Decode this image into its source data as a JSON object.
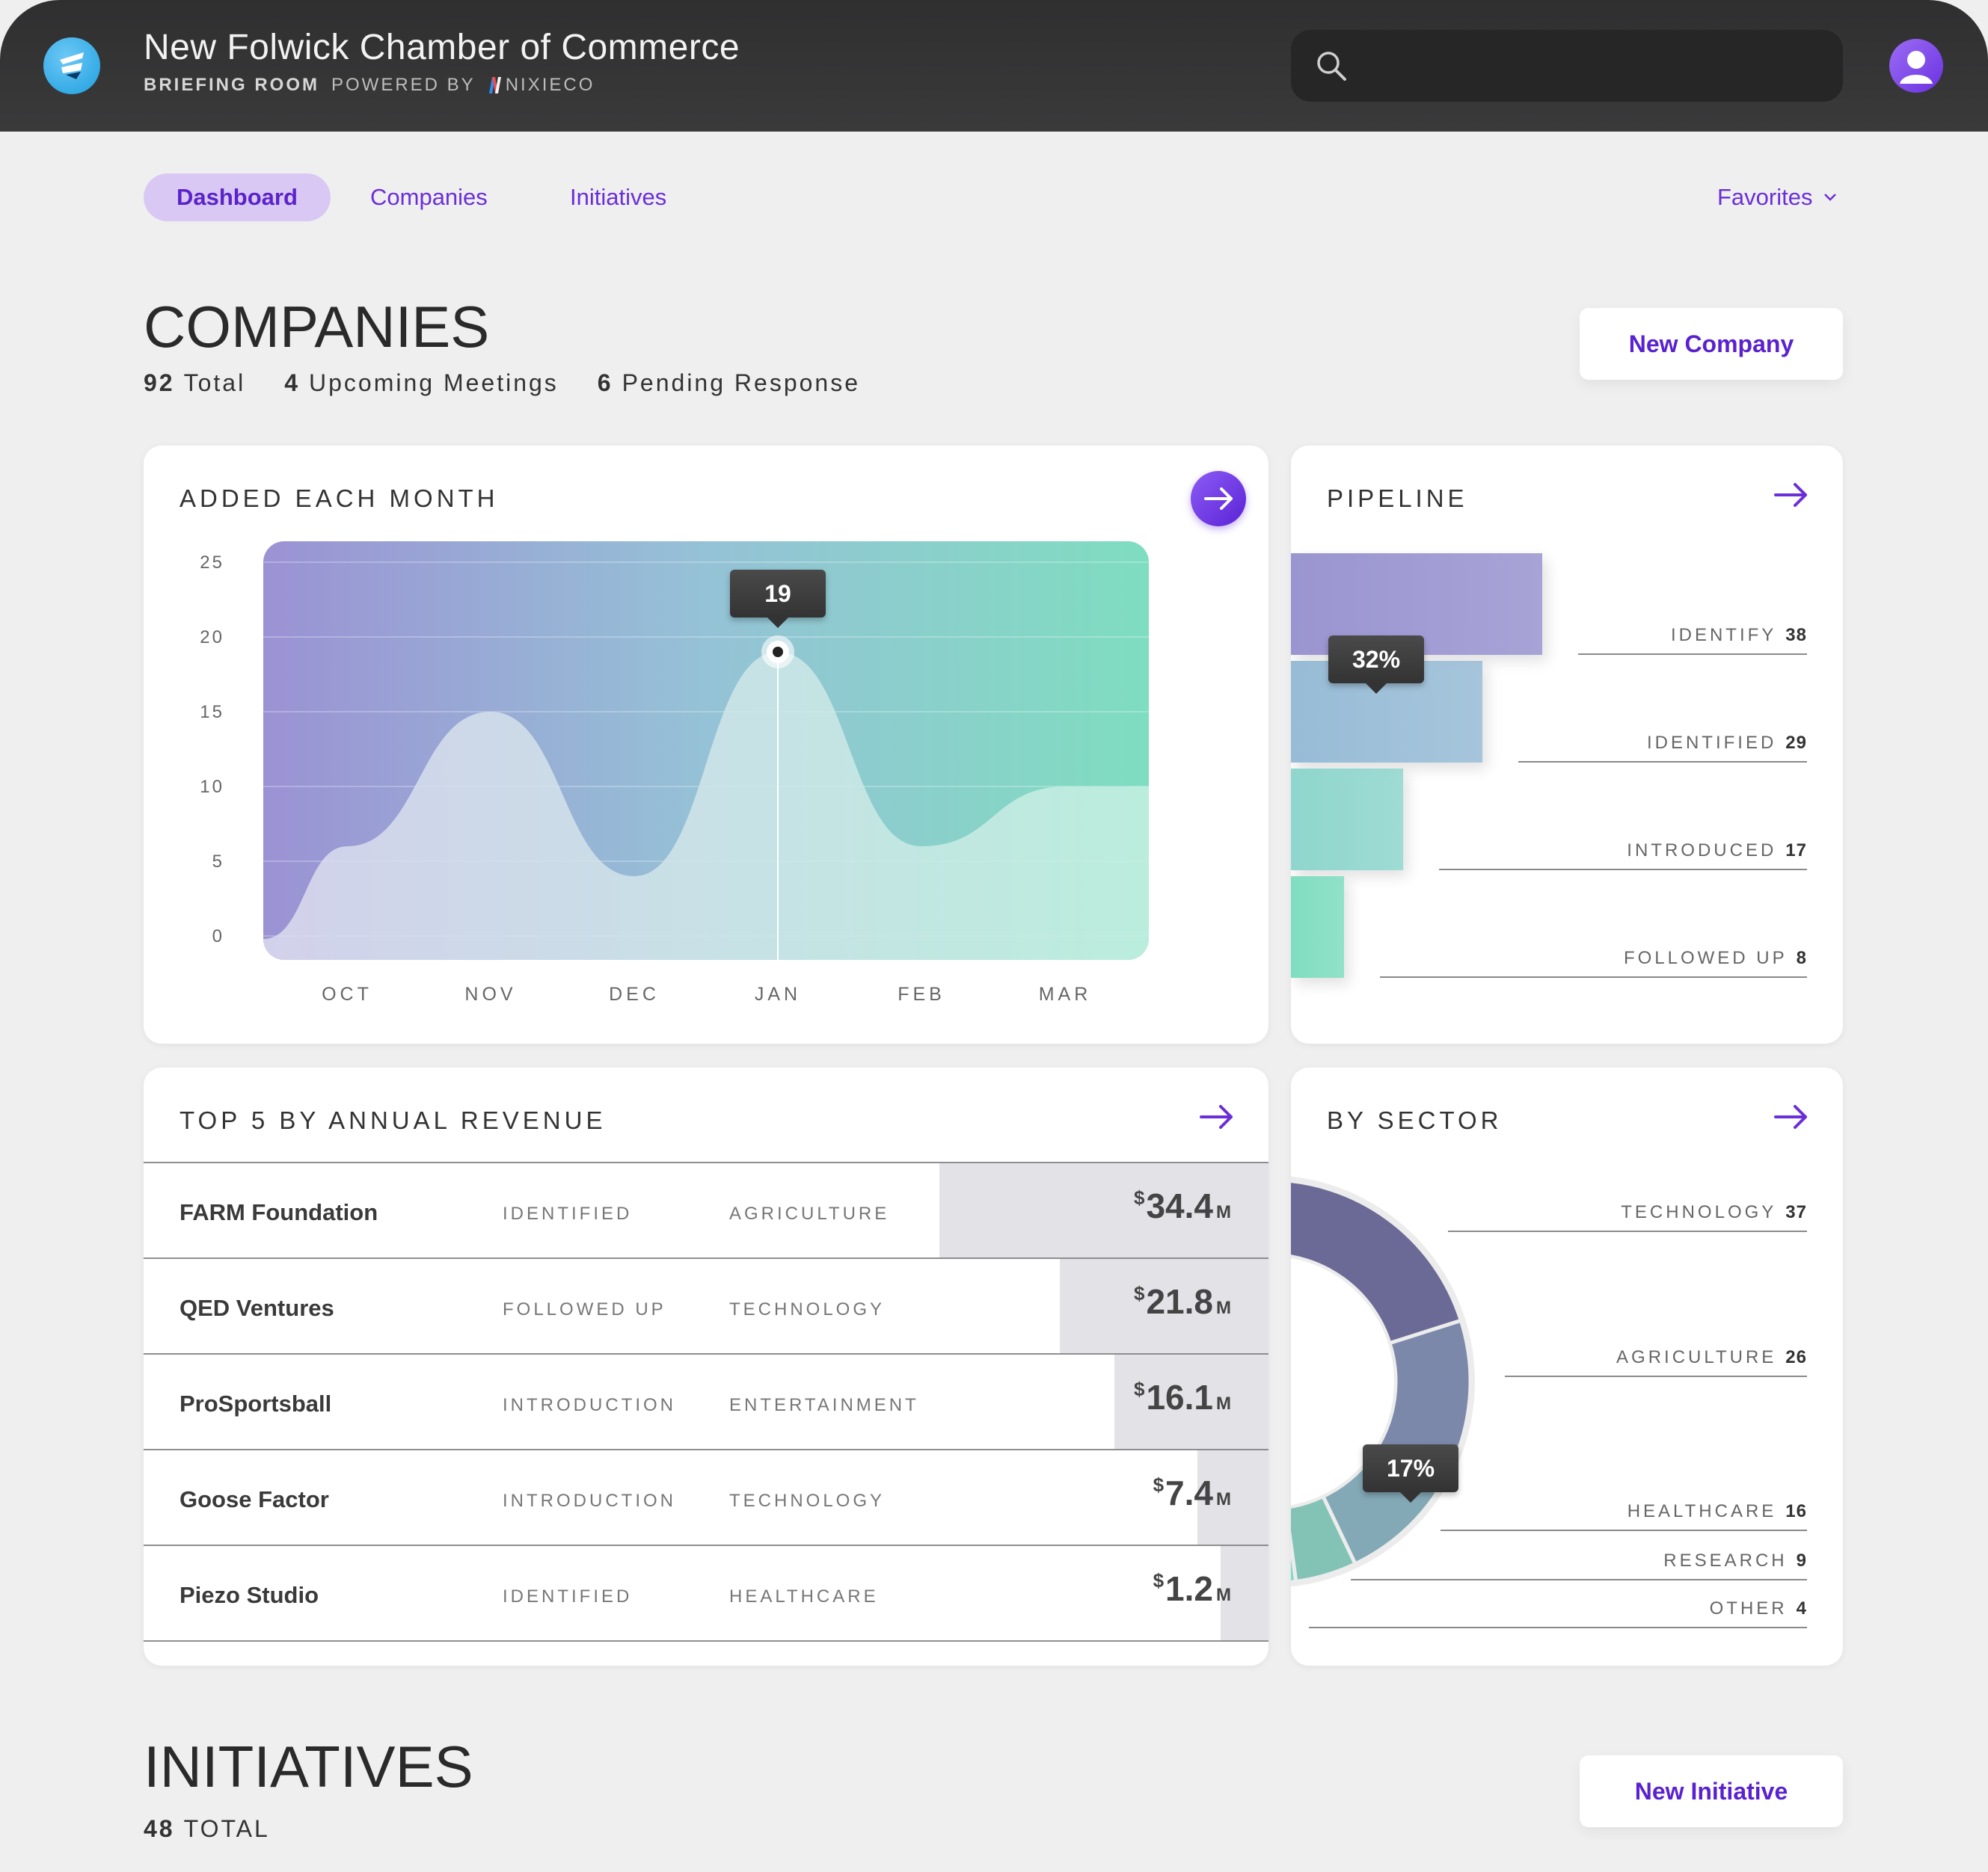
{
  "header": {
    "app_title": "New Folwick Chamber of Commerce",
    "app_subtitle_bold": "BRIEFING ROOM",
    "app_subtitle": "POWERED BY",
    "brand": "NIXIECO",
    "search_placeholder": ""
  },
  "nav": {
    "tabs": [
      {
        "label": "Dashboard",
        "active": true
      },
      {
        "label": "Companies",
        "active": false
      },
      {
        "label": "Initiatives",
        "active": false
      }
    ],
    "favorites_label": "Favorites"
  },
  "companies": {
    "title": "COMPANIES",
    "stats": [
      {
        "count": "92",
        "label": "Total"
      },
      {
        "count": "4",
        "label": "Upcoming Meetings"
      },
      {
        "count": "6",
        "label": "Pending Response"
      }
    ],
    "new_button_label": "New Company"
  },
  "added_card": {
    "title": "ADDED EACH MONTH",
    "tooltip": "19"
  },
  "pipeline_card": {
    "title": "PIPELINE",
    "tooltip": "32%",
    "stages": [
      {
        "label": "IDENTIFY",
        "value": "38"
      },
      {
        "label": "IDENTIFIED",
        "value": "29"
      },
      {
        "label": "INTRODUCED",
        "value": "17"
      },
      {
        "label": "FOLLOWED UP",
        "value": "8"
      }
    ]
  },
  "revenue_card": {
    "title": "TOP 5 BY ANNUAL REVENUE",
    "rows": [
      {
        "name": "FARM Foundation",
        "stage": "IDENTIFIED",
        "sector": "AGRICULTURE",
        "currency": "$",
        "value": "34.4",
        "unit": "M",
        "amount": 34.4
      },
      {
        "name": "QED Ventures",
        "stage": "FOLLOWED UP",
        "sector": "TECHNOLOGY",
        "currency": "$",
        "value": "21.8",
        "unit": "M",
        "amount": 21.8
      },
      {
        "name": "ProSportsball",
        "stage": "INTRODUCTION",
        "sector": "ENTERTAINMENT",
        "currency": "$",
        "value": "16.1",
        "unit": "M",
        "amount": 16.1
      },
      {
        "name": "Goose Factor",
        "stage": "INTRODUCTION",
        "sector": "TECHNOLOGY",
        "currency": "$",
        "value": "7.4",
        "unit": "M",
        "amount": 7.4
      },
      {
        "name": "Piezo Studio",
        "stage": "IDENTIFIED",
        "sector": "HEALTHCARE",
        "currency": "$",
        "value": "1.2",
        "unit": "M",
        "amount": 1.2
      }
    ]
  },
  "sector_card": {
    "title": "BY SECTOR",
    "tooltip": "17%",
    "sectors": [
      {
        "label": "TECHNOLOGY",
        "value": "37"
      },
      {
        "label": "AGRICULTURE",
        "value": "26"
      },
      {
        "label": "HEALTHCARE",
        "value": "16"
      },
      {
        "label": "RESEARCH",
        "value": "9"
      },
      {
        "label": "OTHER",
        "value": "4"
      }
    ]
  },
  "initiatives": {
    "title": "INITIATIVES",
    "total_count": "48",
    "total_label": "TOTAL",
    "new_button_label": "New Initiative"
  },
  "colors": {
    "accent": "#6b2fd9",
    "purple": "#9b8fd3",
    "teal": "#7fdcbf",
    "donut_dark": "#6a6b96"
  },
  "chart_data": [
    {
      "type": "area",
      "title": "ADDED EACH MONTH",
      "categories": [
        "OCT",
        "NOV",
        "DEC",
        "JAN",
        "FEB",
        "MAR"
      ],
      "values": [
        6,
        15,
        4,
        19,
        6,
        10
      ],
      "ylim": [
        0,
        25
      ],
      "yticks": [
        0,
        5,
        10,
        15,
        20,
        25
      ],
      "highlight": {
        "category": "JAN",
        "value": 19
      }
    },
    {
      "type": "bar",
      "title": "PIPELINE",
      "categories": [
        "IDENTIFY",
        "IDENTIFIED",
        "INTRODUCED",
        "FOLLOWED UP"
      ],
      "values": [
        38,
        29,
        17,
        8
      ]
    },
    {
      "type": "pie",
      "title": "BY SECTOR",
      "categories": [
        "TECHNOLOGY",
        "AGRICULTURE",
        "HEALTHCARE",
        "RESEARCH",
        "OTHER"
      ],
      "values": [
        37,
        26,
        16,
        9,
        4
      ]
    }
  ]
}
